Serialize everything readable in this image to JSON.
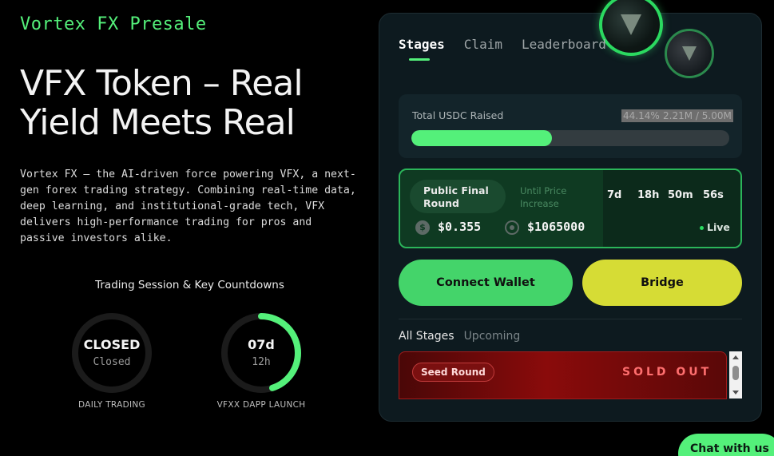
{
  "hero": {
    "brand": "Vortex FX Presale",
    "title": "VFX Token – Real Yield Meets Real",
    "description": "Vortex FX — the AI-driven force powering VFX, a next-gen forex trading strategy. Combining real-time data, deep learning, and institutional-grade tech, VFX delivers high-performance trading for pros and passive investors alike."
  },
  "session": {
    "title": "Trading Session & Key Countdowns",
    "rings": [
      {
        "main": "CLOSED",
        "sub": "Closed",
        "caption": "DAILY TRADING",
        "progress": 0
      },
      {
        "main": "07d",
        "sub": "12h",
        "caption": "VFXX DAPP LAUNCH",
        "progress": 0.45
      }
    ]
  },
  "panel": {
    "tabs": [
      "Stages",
      "Claim",
      "Leaderboard"
    ],
    "active_tab": "Stages",
    "raised": {
      "label": "Total USDC Raised",
      "percent_text": "44.14%",
      "amount_text": "2.21M / 5.00M",
      "progress": 0.4414
    },
    "stage": {
      "name": "Public Final Round",
      "until_label": "Until Price Increase",
      "countdown": [
        "7d",
        "18h",
        "50m",
        "56s"
      ],
      "price": "$0.355",
      "target": "$1065000",
      "status": "Live"
    },
    "buttons": {
      "connect": "Connect Wallet",
      "bridge": "Bridge"
    },
    "sub_tabs": [
      "All Stages",
      "Upcoming"
    ],
    "round_card": {
      "badge": "Seed Round",
      "status": "SOLD OUT"
    }
  },
  "chat": {
    "label": "Chat with us"
  },
  "colors": {
    "accent_green": "#54f07a",
    "bridge_yellow": "#d6dc35",
    "sold_out_red": "#ff6f6f"
  }
}
